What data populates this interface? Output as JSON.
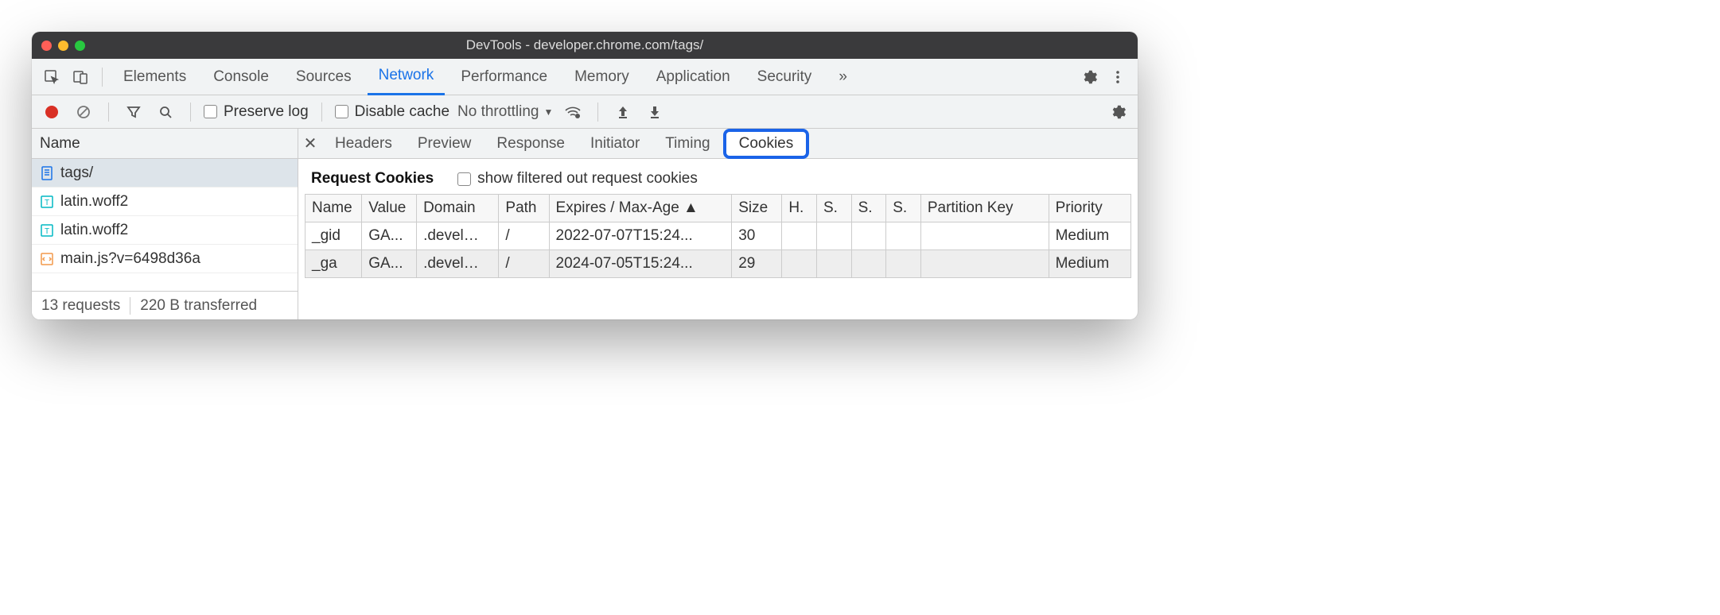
{
  "window": {
    "title": "DevTools - developer.chrome.com/tags/"
  },
  "tabs": {
    "items": [
      "Elements",
      "Console",
      "Sources",
      "Network",
      "Performance",
      "Memory",
      "Application",
      "Security"
    ],
    "active": "Network",
    "more": "»"
  },
  "toolbar": {
    "preserve_log": "Preserve log",
    "disable_cache": "Disable cache",
    "throttling": "No throttling"
  },
  "left": {
    "header": "Name",
    "requests": [
      {
        "name": "tags/",
        "icon": "doc",
        "selected": true
      },
      {
        "name": "latin.woff2",
        "icon": "font",
        "selected": false
      },
      {
        "name": "latin.woff2",
        "icon": "font",
        "selected": false
      },
      {
        "name": "main.js?v=6498d36a",
        "icon": "js",
        "selected": false
      }
    ],
    "status_requests": "13 requests",
    "status_transferred": "220 B transferred"
  },
  "detail_tabs": {
    "items": [
      "Headers",
      "Preview",
      "Response",
      "Initiator",
      "Timing",
      "Cookies"
    ],
    "active": "Cookies"
  },
  "cookies": {
    "header": "Request Cookies",
    "show_filtered": "show filtered out request cookies",
    "columns": [
      "Name",
      "Value",
      "Domain",
      "Path",
      "Expires / Max-Age ▲",
      "Size",
      "H.",
      "S.",
      "S.",
      "S.",
      "Partition Key",
      "Priority"
    ],
    "rows": [
      {
        "name": "_gid",
        "value": "GA...",
        "domain": ".devel…",
        "path": "/",
        "expires": "2022-07-07T15:24...",
        "size": "30",
        "h": "",
        "s1": "",
        "s2": "",
        "s3": "",
        "pk": "",
        "priority": "Medium"
      },
      {
        "name": "_ga",
        "value": "GA...",
        "domain": ".devel…",
        "path": "/",
        "expires": "2024-07-05T15:24...",
        "size": "29",
        "h": "",
        "s1": "",
        "s2": "",
        "s3": "",
        "pk": "",
        "priority": "Medium"
      }
    ]
  }
}
